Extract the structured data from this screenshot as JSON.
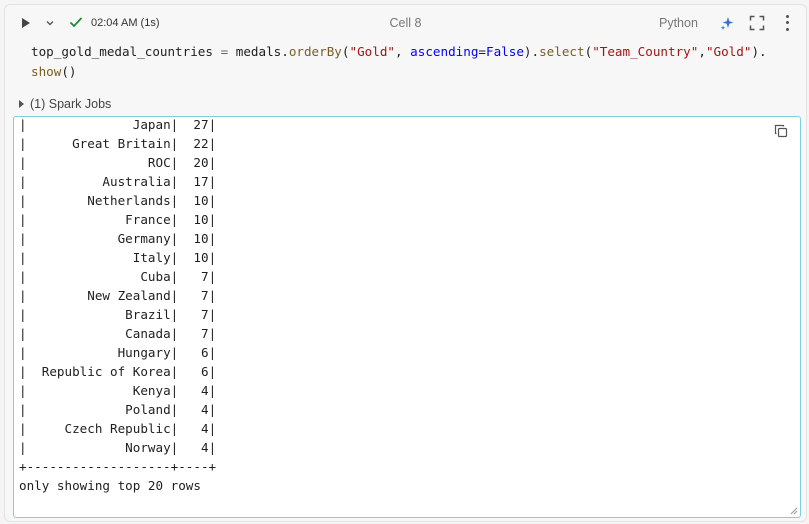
{
  "header": {
    "run_label": "Run cell",
    "status_time": "02:04 AM (1s)",
    "cell_title": "Cell 8",
    "language": "Python"
  },
  "code": {
    "var": "top_gold_medal_countries",
    "eq": " = ",
    "obj": "medals.",
    "m1": "orderBy",
    "p1": "(",
    "s1": "\"Gold\"",
    "c1": ", ",
    "k1": "ascending",
    "eq2": "=",
    "k2": "False",
    "p2": ").",
    "m2": "select",
    "p3": "(",
    "s2": "\"Team_Country\"",
    "c2": ",",
    "s3": "\"Gold\"",
    "p4": ").",
    "m3": "show",
    "p5": "()"
  },
  "spark_jobs": "(1) Spark Jobs",
  "output": {
    "rows": [
      {
        "country": "Japan",
        "gold": "27"
      },
      {
        "country": "Great Britain",
        "gold": "22"
      },
      {
        "country": "ROC",
        "gold": "20"
      },
      {
        "country": "Australia",
        "gold": "17"
      },
      {
        "country": "Netherlands",
        "gold": "10"
      },
      {
        "country": "France",
        "gold": "10"
      },
      {
        "country": "Germany",
        "gold": "10"
      },
      {
        "country": "Italy",
        "gold": "10"
      },
      {
        "country": "Cuba",
        "gold": "7"
      },
      {
        "country": "New Zealand",
        "gold": "7"
      },
      {
        "country": "Brazil",
        "gold": "7"
      },
      {
        "country": "Canada",
        "gold": "7"
      },
      {
        "country": "Hungary",
        "gold": "6"
      },
      {
        "country": "Republic of Korea",
        "gold": "6"
      },
      {
        "country": "Kenya",
        "gold": "4"
      },
      {
        "country": "Poland",
        "gold": "4"
      },
      {
        "country": "Czech Republic",
        "gold": "4"
      },
      {
        "country": "Norway",
        "gold": "4"
      }
    ],
    "separator": "+-------------------+----+",
    "footer": "only showing top 20 rows"
  },
  "colors": {
    "accent": "#7fd0d9",
    "check": "#1e8a3a",
    "assistant": "#3b6fd6"
  }
}
